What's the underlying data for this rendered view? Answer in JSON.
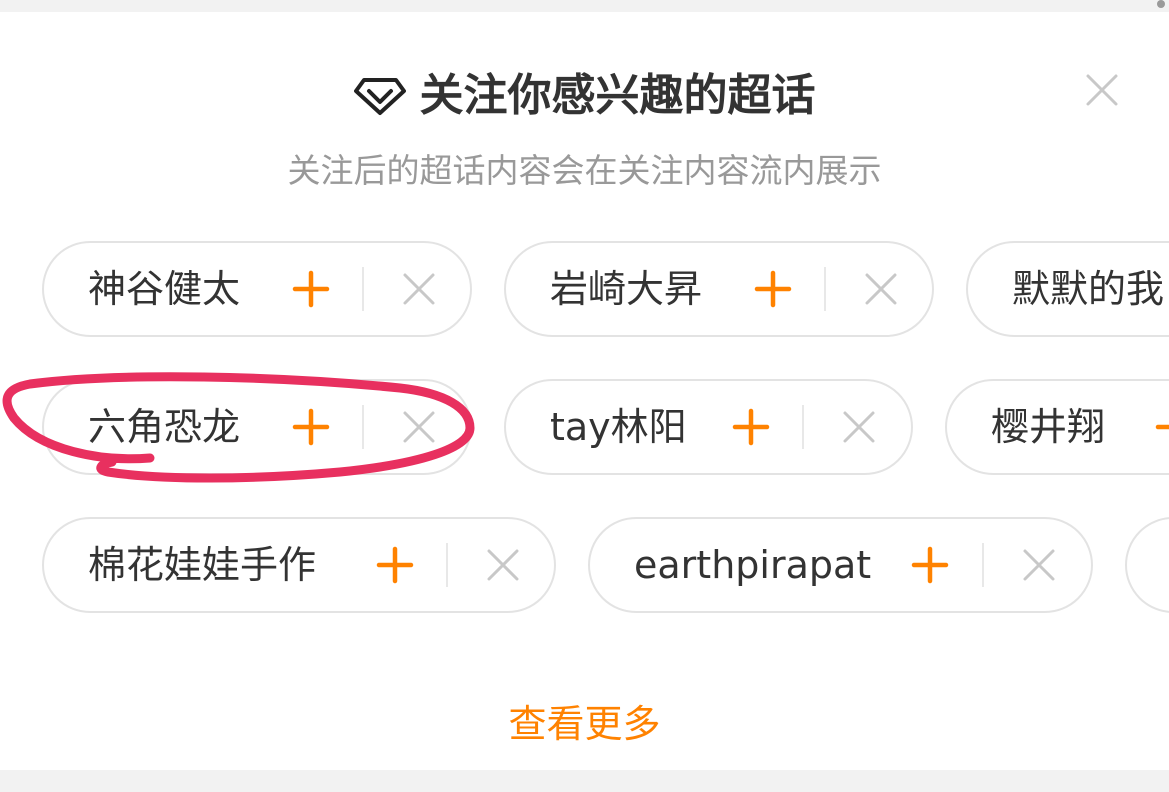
{
  "header": {
    "title": "关注你感兴趣的超话",
    "subtitle": "关注后的超话内容会在关注内容流内展示",
    "title_icon": "diamond-icon",
    "close_icon": "close-icon"
  },
  "chips": [
    {
      "label": "神谷健太"
    },
    {
      "label": "岩崎大昇"
    },
    {
      "label": "默默的我"
    },
    {
      "label": "六角恐龙"
    },
    {
      "label": "tay林阳"
    },
    {
      "label": "樱井翔"
    },
    {
      "label": "棉花娃娃手作"
    },
    {
      "label": "earthpirapat"
    }
  ],
  "footer": {
    "see_more": "查看更多"
  },
  "colors": {
    "accent": "#ff8200",
    "annotation": "#e8305f",
    "text": "#333333",
    "subtext": "#999999",
    "chip_border": "#e3e3e3"
  }
}
